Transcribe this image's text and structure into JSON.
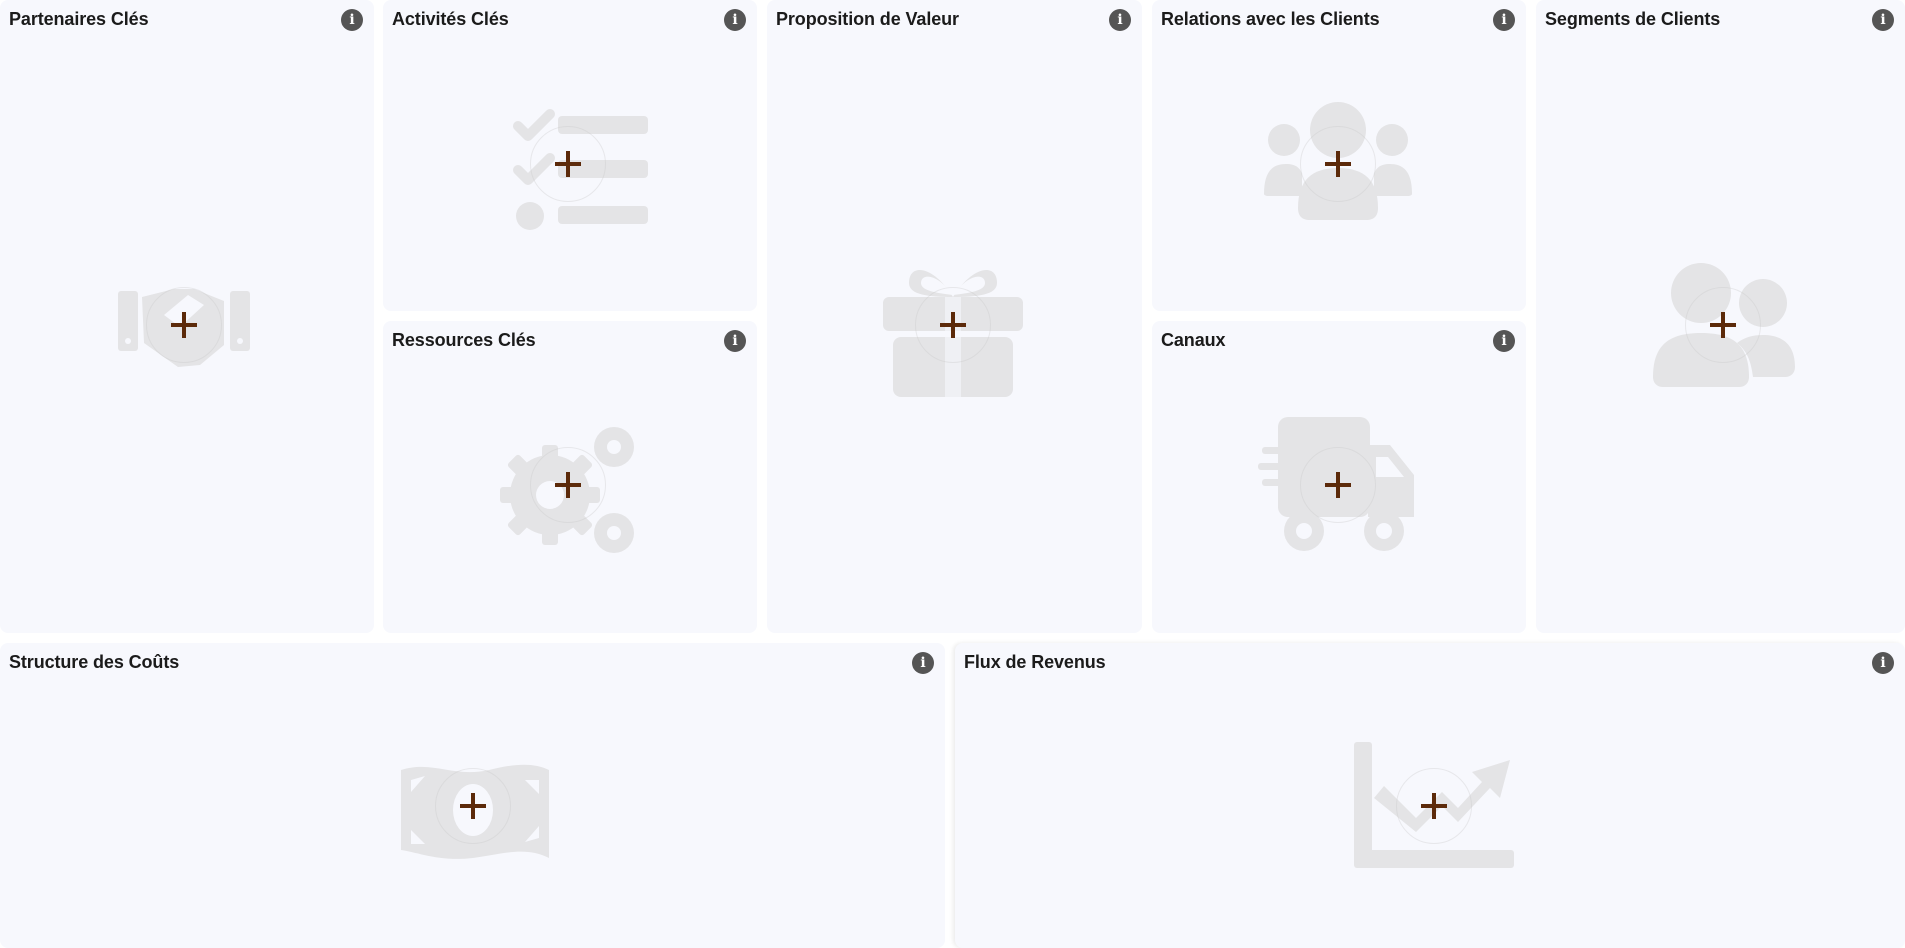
{
  "colors": {
    "card_background": "#f7f8fd",
    "placeholder_icon": "#e4e4e6",
    "plus": "#5c2a0a",
    "info_button": "#555555"
  },
  "info_glyph": "i",
  "blocks": {
    "key_partners": {
      "title": "Partenaires Clés",
      "icon": "handshake-icon"
    },
    "key_activities": {
      "title": "Activités Clés",
      "icon": "checklist-icon"
    },
    "key_resources": {
      "title": "Ressources Clés",
      "icon": "gears-icon"
    },
    "value_prop": {
      "title": "Proposition de Valeur",
      "icon": "gift-icon"
    },
    "relations": {
      "title": "Relations avec les Clients",
      "icon": "users-group-icon"
    },
    "channels": {
      "title": "Canaux",
      "icon": "truck-icon"
    },
    "segments": {
      "title": "Segments de Clients",
      "icon": "users-icon"
    },
    "costs": {
      "title": "Structure des Coûts",
      "icon": "money-bill-icon"
    },
    "revenue": {
      "title": "Flux de Revenus",
      "icon": "chart-line-up-icon"
    }
  }
}
